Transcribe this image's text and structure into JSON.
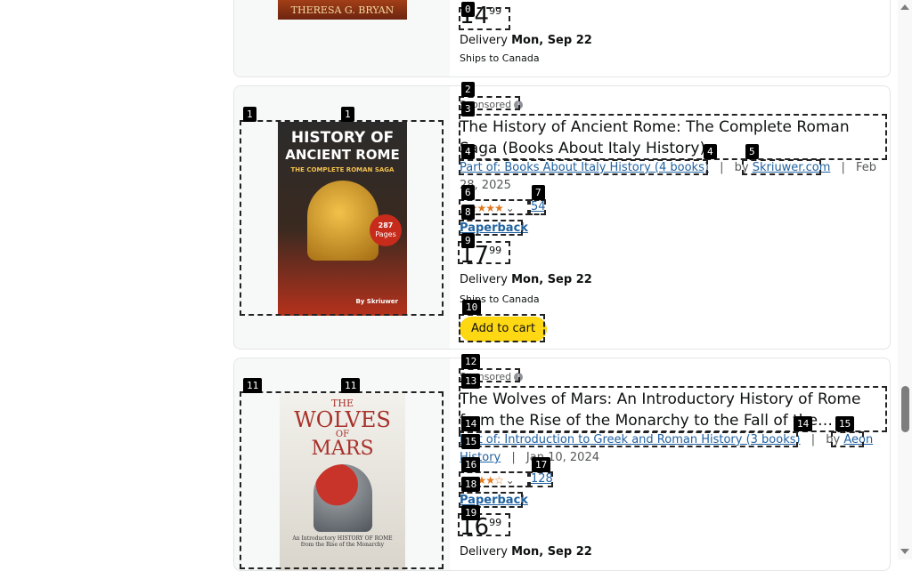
{
  "card0": {
    "cover_author": "THERESA G. BRYAN",
    "price": {
      "whole": "14",
      "fraction": "99"
    },
    "delivery_prefix": "Delivery",
    "delivery_date": "Mon, Sep 22",
    "ships_to": "Ships to Canada"
  },
  "card1": {
    "sponsored_label": "Sponsored",
    "title": "The History of Ancient Rome: The Complete Roman Saga (Books About Italy History)",
    "series_link": "Part of: Books About Italy History (4 books)",
    "sep": "|",
    "by_label": "by",
    "author_link": "Skriuwer.com",
    "date": "Feb 28, 2025",
    "stars": "★★★★★",
    "rating_count": "54",
    "format": "Paperback",
    "price": {
      "whole": "17",
      "fraction": "99"
    },
    "delivery_prefix": "Delivery",
    "delivery_date": "Mon, Sep 22",
    "ships_to": "Ships to Canada",
    "add_to_cart": "Add to cart",
    "cover": {
      "line1": "HISTORY OF",
      "line2": "ANCIENT ROME",
      "line3": "THE COMPLETE ROMAN SAGA",
      "pages_num": "287",
      "pages_label": "Pages",
      "author": "By Skriuwer"
    }
  },
  "card2": {
    "sponsored_label": "Sponsored",
    "title": "The Wolves of Mars: An Introductory History of Rome from the Rise of the Monarchy to the Fall of the Western Empire",
    "series_link": "Part of: Introduction to Greek and Roman History (3 books)",
    "sep": "|",
    "by_label": "by",
    "author_link": "Aeon History",
    "date": "Jan 10, 2024",
    "stars": "★★★★☆",
    "rating_count": "128",
    "format": "Paperback",
    "price": {
      "whole": "16",
      "fraction": "99"
    },
    "delivery_prefix": "Delivery",
    "delivery_date": "Mon, Sep 22",
    "cover": {
      "line1": "THE",
      "line2": "WOLVES",
      "line3": "OF",
      "line4": "MARS",
      "subtitle": "An Introductory HISTORY OF ROME from the Rise of the Monarchy"
    }
  },
  "badges": [
    "0",
    "1",
    "1",
    "2",
    "3",
    "4",
    "4",
    "5",
    "6",
    "7",
    "8",
    "9",
    "10",
    "11",
    "11",
    "12",
    "13",
    "14",
    "14",
    "15",
    "15",
    "16",
    "17",
    "18",
    "19"
  ],
  "colors": {
    "accent_link": "#2162a1",
    "cart_button": "#ffd814",
    "star": "#de7921"
  }
}
